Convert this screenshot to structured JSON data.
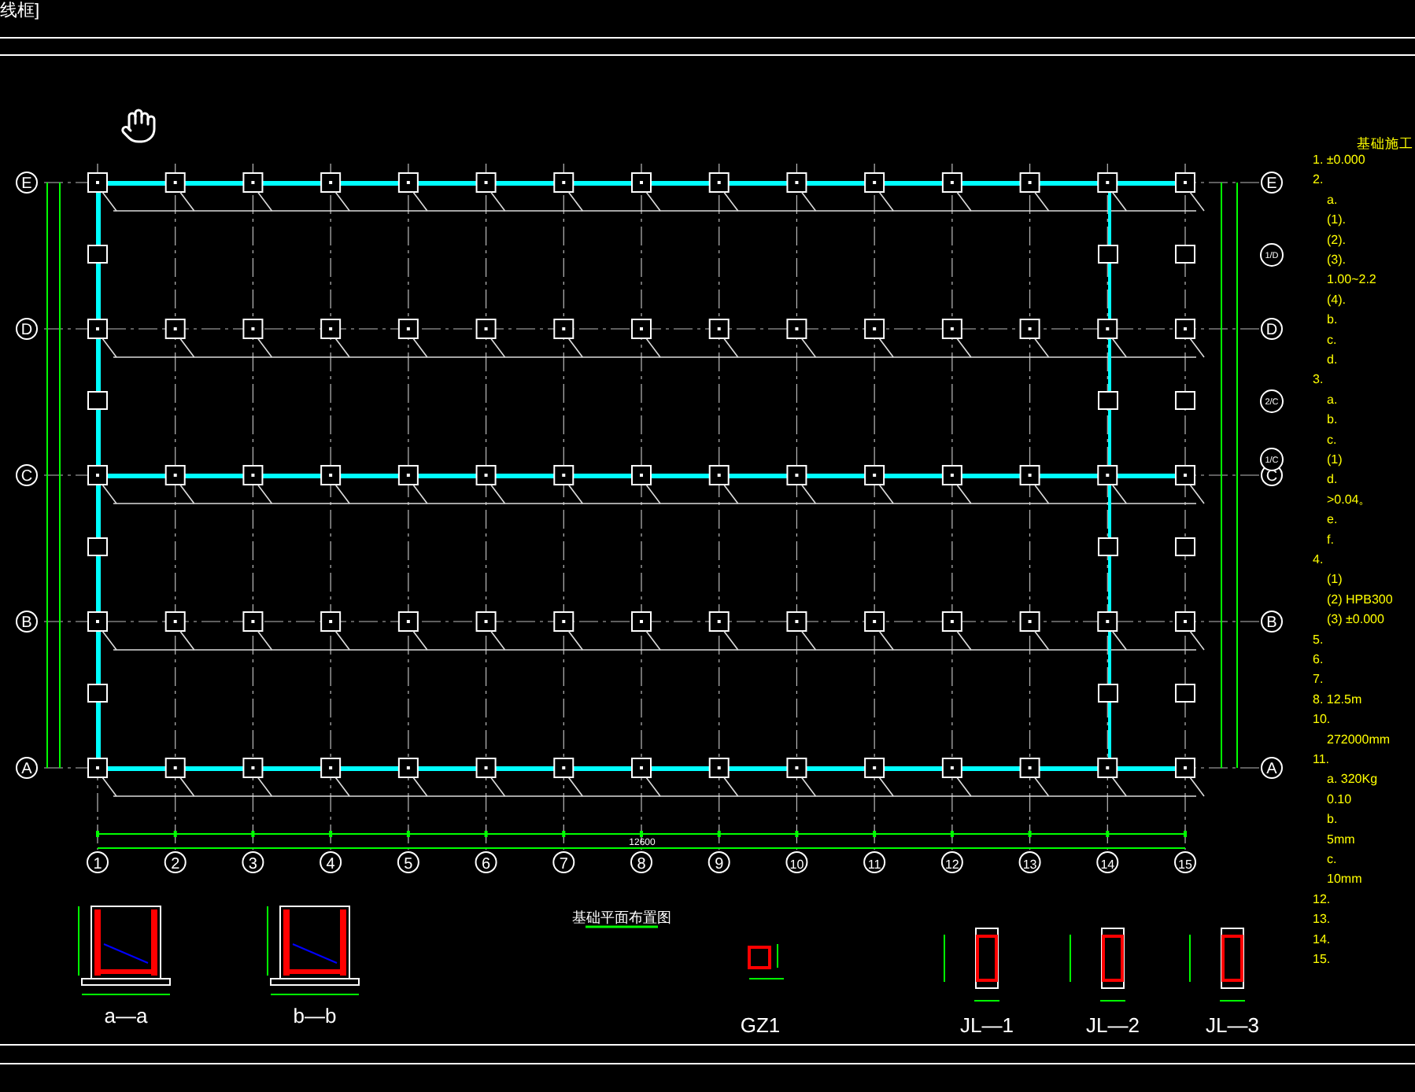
{
  "viewport_label": "线框]",
  "column_axes": [
    "1",
    "2",
    "3",
    "4",
    "5",
    "6",
    "7",
    "8",
    "9",
    "10",
    "11",
    "12",
    "13",
    "14",
    "15"
  ],
  "row_axes": [
    {
      "label": "E",
      "beam": true
    },
    {
      "label": "D",
      "beam": false
    },
    {
      "label": "C",
      "beam": true
    },
    {
      "label": "B",
      "beam": false
    },
    {
      "label": "A",
      "beam": true
    }
  ],
  "right_row_axes": [
    "E",
    "D",
    "C",
    "B",
    "A"
  ],
  "right_sub_axes": [
    "1/D",
    "2/C",
    "1/C"
  ],
  "total_dimension": "12600",
  "notes": {
    "title": "基础施工",
    "lines": [
      {
        "text": "1. ±0.000"
      },
      {
        "text": "2.",
        "children": [
          {
            "text": "a."
          },
          {
            "text": "(1)."
          },
          {
            "text": "(2)."
          },
          {
            "text": "(3)."
          },
          {
            "text": "1.00~2.2"
          },
          {
            "text": "(4)."
          },
          {
            "text": "b."
          },
          {
            "text": "c."
          },
          {
            "text": "d."
          }
        ]
      },
      {
        "text": "3.",
        "children": [
          {
            "text": "a."
          },
          {
            "text": "b."
          },
          {
            "text": "c."
          },
          {
            "text": "(1)"
          },
          {
            "text": "d."
          },
          {
            "text": ">0.04。"
          },
          {
            "text": "e."
          },
          {
            "text": "f."
          }
        ]
      },
      {
        "text": "4.",
        "children": [
          {
            "text": "(1)"
          },
          {
            "text": "(2) HPB300"
          },
          {
            "text": "(3) ±0.000"
          }
        ]
      },
      {
        "text": "5."
      },
      {
        "text": "6."
      },
      {
        "text": "7."
      },
      {
        "text": "8. 12.5m"
      },
      {
        "text": "10.",
        "children": [
          {
            "text": "272000mm"
          }
        ]
      },
      {
        "text": "11.",
        "children": [
          {
            "text": "a. 320Kg"
          },
          {
            "text": "0.10"
          },
          {
            "text": "b."
          },
          {
            "text": "5mm"
          },
          {
            "text": "c."
          },
          {
            "text": "10mm"
          }
        ]
      },
      {
        "text": "12."
      },
      {
        "text": "13."
      },
      {
        "text": "14."
      },
      {
        "text": "15."
      }
    ]
  },
  "plan_title": "基础平面布置图",
  "details": [
    {
      "label": "a—a",
      "kind": "wall"
    },
    {
      "label": "b—b",
      "kind": "wall"
    },
    {
      "label": "GZ1",
      "kind": "column"
    },
    {
      "label": "JL—1",
      "kind": "beam"
    },
    {
      "label": "JL—2",
      "kind": "beam"
    },
    {
      "label": "JL—3",
      "kind": "beam"
    }
  ]
}
